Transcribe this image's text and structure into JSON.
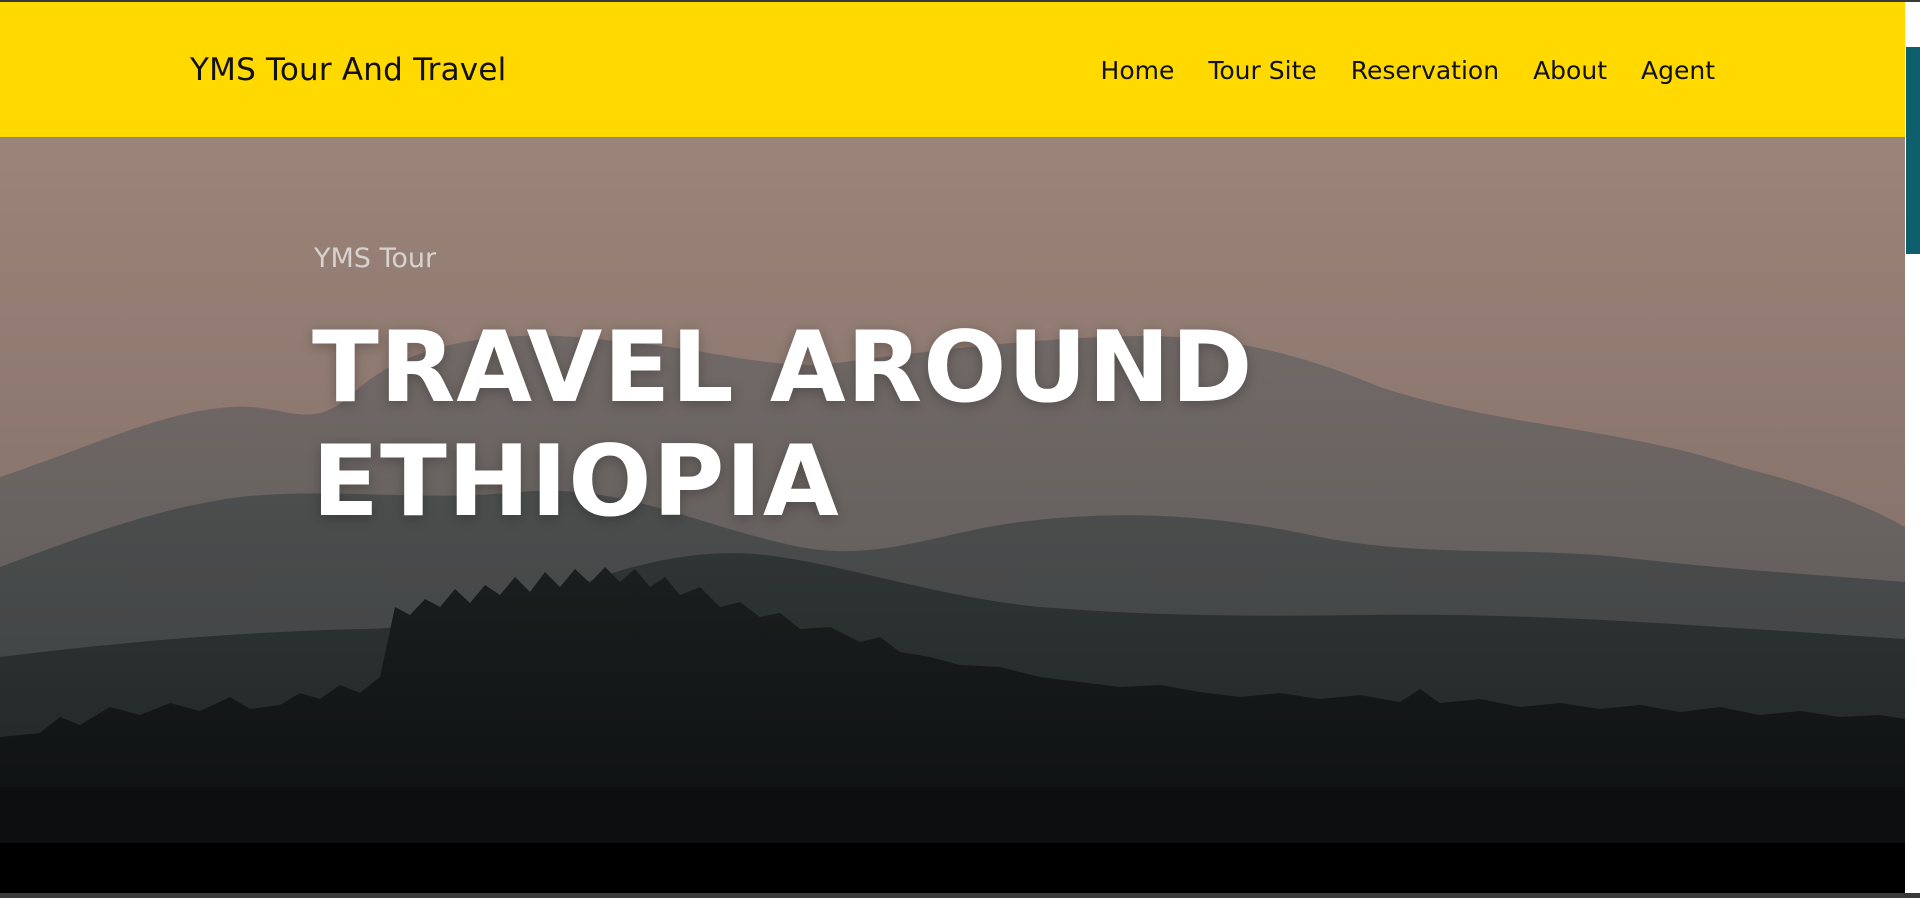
{
  "navbar": {
    "brand": "YMS Tour And Travel",
    "links": [
      "Home",
      "Tour Site",
      "Reservation",
      "About",
      "Agent"
    ],
    "background": "#ffd900"
  },
  "hero": {
    "subtitle": "YMS Tour",
    "title_line1": "TRAVEL AROUND",
    "title_line2": "ETHIOPIA",
    "image": "misty mountain ridges at dusk with tree silhouettes"
  },
  "scrollbar": {
    "thumb_color": "#0e5f6c"
  }
}
